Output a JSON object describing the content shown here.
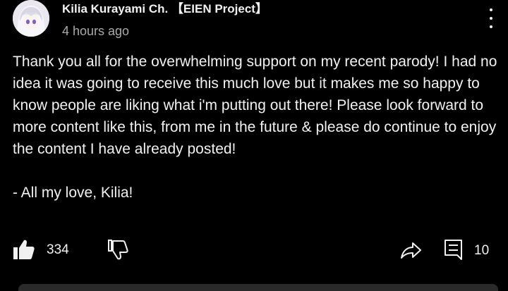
{
  "post": {
    "author": "Kilia Kurayami Ch. 【EIEN Project】",
    "timestamp": "4 hours ago",
    "paragraphs": [
      "Thank you all for the overwhelming support on my recent parody! I had no idea it was going to receive this much love but it makes me so happy to know people are liking what i'm putting out there! Please look forward to more content like this, from me in the future & please do continue to enjoy the content I have already posted!",
      "- All my love, Kilia!"
    ],
    "actions": {
      "like_count": "334",
      "comment_count": "10"
    }
  },
  "icons": {
    "avatar": "avatar",
    "menu": "more-vertical-icon",
    "like": "thumbs-up-icon",
    "dislike": "thumbs-down-icon",
    "share": "share-icon",
    "comment": "comment-icon"
  }
}
